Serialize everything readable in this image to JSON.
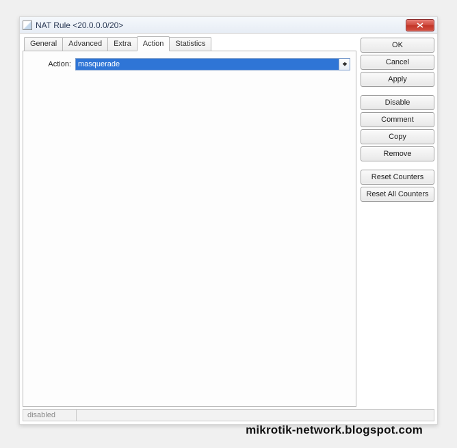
{
  "window": {
    "title": "NAT Rule <20.0.0.0/20>"
  },
  "tabs": {
    "items": [
      {
        "label": "General"
      },
      {
        "label": "Advanced"
      },
      {
        "label": "Extra"
      },
      {
        "label": "Action"
      },
      {
        "label": "Statistics"
      }
    ],
    "active_index": 3
  },
  "form": {
    "action": {
      "label": "Action:",
      "value": "masquerade"
    }
  },
  "buttons": {
    "ok": "OK",
    "cancel": "Cancel",
    "apply": "Apply",
    "disable": "Disable",
    "comment": "Comment",
    "copy": "Copy",
    "remove": "Remove",
    "reset_counters": "Reset Counters",
    "reset_all_counters": "Reset All Counters"
  },
  "status": {
    "text": "disabled"
  },
  "watermark": "mikrotik-network.blogspot.com"
}
